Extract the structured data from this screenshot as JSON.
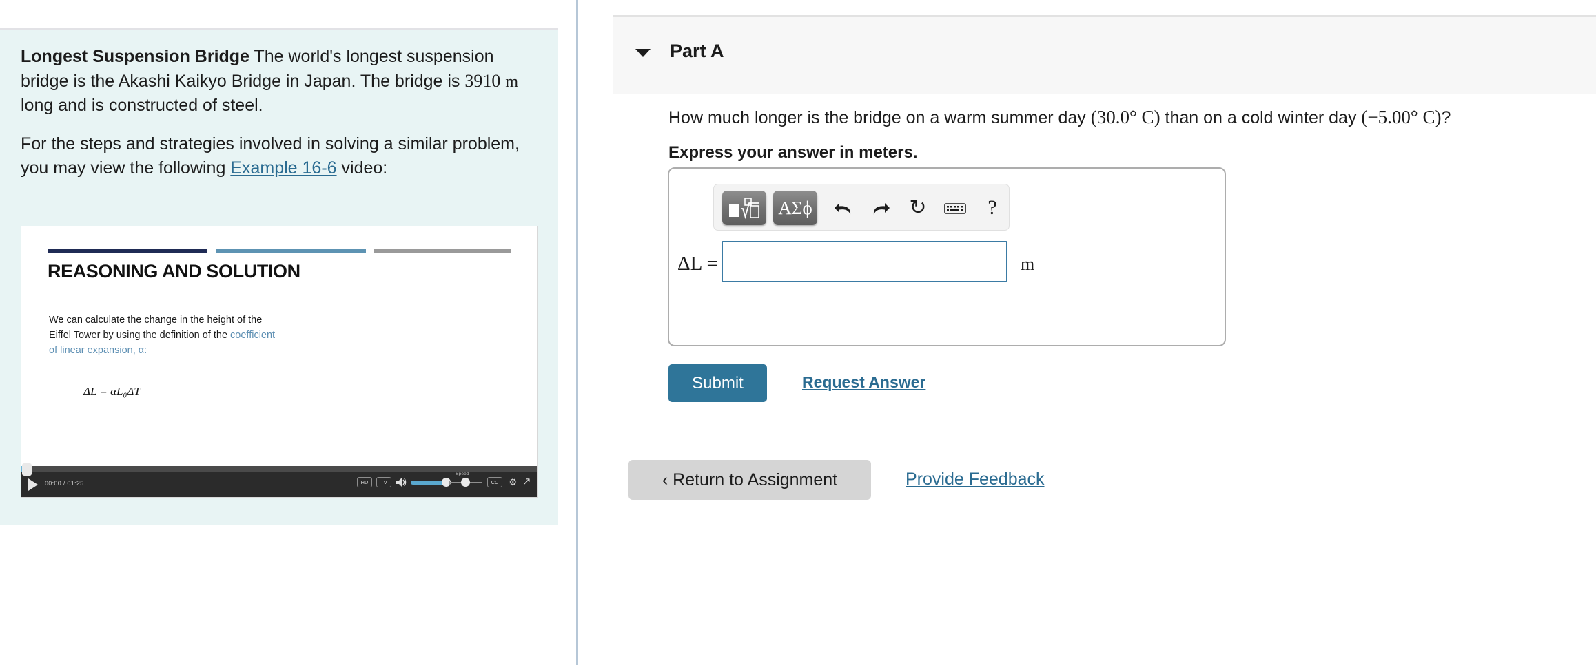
{
  "problem": {
    "title": "Longest Suspension Bridge",
    "statement_1": " The world's longest suspension bridge is the Akashi Kaikyo Bridge in Japan. The bridge is ",
    "bridge_length": "3910",
    "bridge_length_unit": "m",
    "statement_2": " long and is constructed of steel.",
    "statement_3_pre": "For the steps and strategies involved in solving a similar problem, you may view the following ",
    "example_link": "Example 16-6",
    "statement_3_post": " video:"
  },
  "video": {
    "slide_title": "REASONING AND SOLUTION",
    "slide_body_1": "We can calculate the change in the height of the Eiffel Tower by using the definition of the ",
    "slide_body_accent": "coefficient of linear expansion",
    "slide_body_2": ", α:",
    "slide_equation": "ΔL = αL₀ΔT",
    "time_display": "00:00 / 01:25",
    "play_label": "play-button",
    "hd_label": "HD",
    "tv_label": "TV",
    "cc_label": "CC",
    "speed_label": "Speed",
    "gear_glyph": "⚙",
    "fullscreen_glyph": "↗",
    "speaker_glyph": "🔊"
  },
  "part": {
    "title": "Part A",
    "question_pre": "How much longer is the bridge on a warm summer day ",
    "warm_temp": "(30.0° C)",
    "question_mid": " than on a cold winter day ",
    "cold_temp": "(−5.00° C)",
    "question_post": "?",
    "instruction": "Express your answer in meters."
  },
  "answer": {
    "label": "ΔL =",
    "value": "",
    "placeholder": "",
    "unit": "m"
  },
  "toolbar": {
    "template_glyph": "■√□",
    "greek_glyph": "ΑΣϕ",
    "undo_glyph": "↶",
    "redo_glyph": "↷",
    "reset_glyph": "↻",
    "keyboard_glyph": "⌨",
    "help_glyph": "?"
  },
  "actions": {
    "submit": "Submit",
    "request_answer": "Request Answer",
    "return_to_assignment": "‹ Return to Assignment",
    "provide_feedback": "Provide Feedback"
  },
  "colors": {
    "problem_bg": "#e8f4f4",
    "accent_link": "#2a6b91",
    "submit_bg": "#2f7599",
    "input_border": "#3b7ba4",
    "divider": "#b6c7d7"
  }
}
